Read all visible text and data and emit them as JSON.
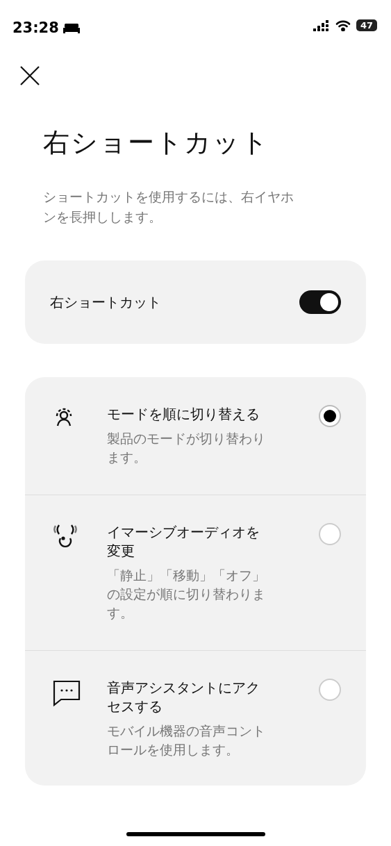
{
  "status_bar": {
    "time": "23:28",
    "battery": "47"
  },
  "title": "右ショートカット",
  "description": "ショートカットを使用するには、右イヤホンを長押しします。",
  "toggle_card": {
    "label": "右ショートカット",
    "on": true
  },
  "options": [
    {
      "kind": "modes",
      "title": "モードを順に切り替える",
      "subtitle": "製品のモードが切り替わります。",
      "selected": true
    },
    {
      "kind": "audio",
      "title": "イマーシブオーディオを変更",
      "subtitle": "「静止」「移動」「オフ」の設定が順に切り替わります。",
      "selected": false
    },
    {
      "kind": "assistant",
      "title": "音声アシスタントにアクセスする",
      "subtitle": "モバイル機器の音声コントロールを使用します。",
      "selected": false
    }
  ]
}
